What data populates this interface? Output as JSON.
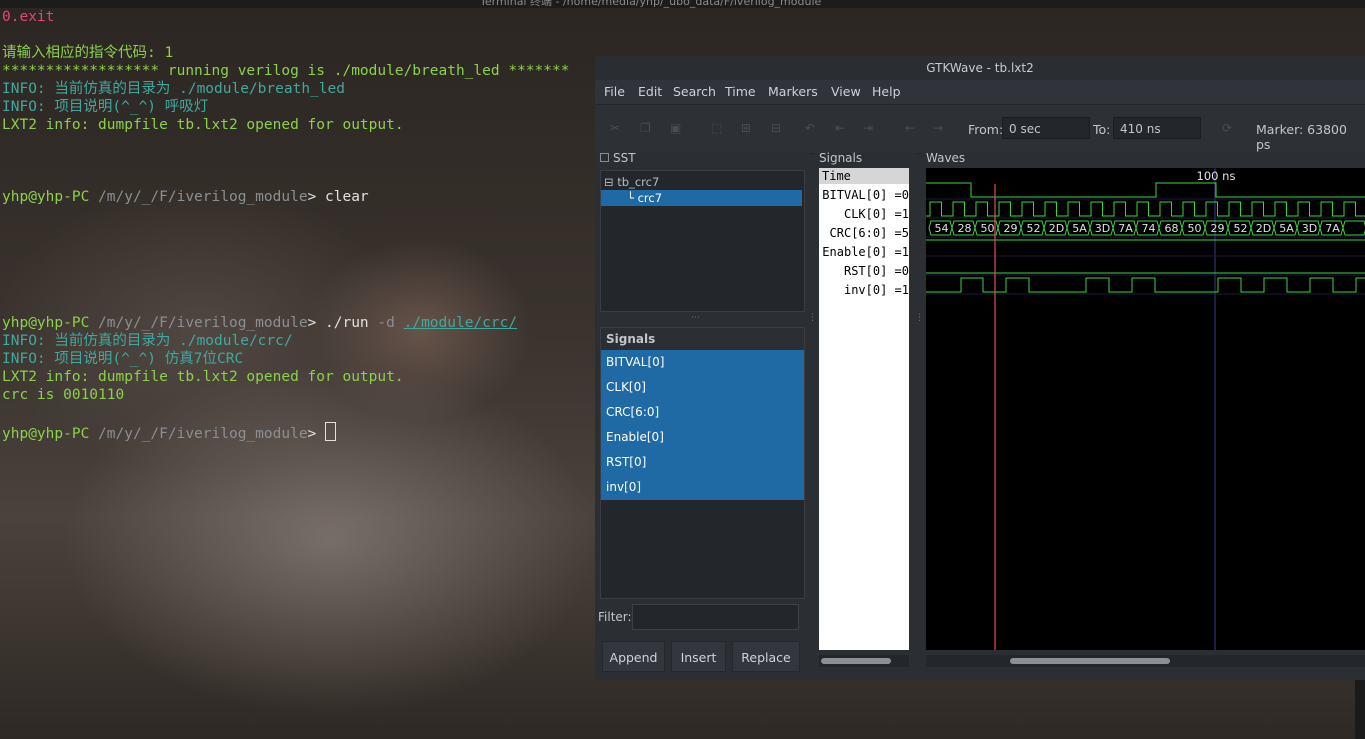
{
  "terminal": {
    "title": "Terminal 终端 - /home/media/yhp/_ubo_data/F/iverilog_module",
    "lines": [
      {
        "segs": [
          {
            "t": "0.exit",
            "c": "p"
          }
        ]
      },
      {
        "segs": []
      },
      {
        "segs": [
          {
            "t": "请输入相应的指令代码: 1",
            "c": "g"
          }
        ]
      },
      {
        "segs": [
          {
            "t": "****************** running verilog is ./module/breath_led *******",
            "c": "g"
          }
        ]
      },
      {
        "segs": [
          {
            "t": "INFO: 当前仿真的目录为 ./module/breath_led",
            "c": "c"
          }
        ]
      },
      {
        "segs": [
          {
            "t": "INFO: 项目说明(^_^) 呼吸灯",
            "c": "c"
          }
        ]
      },
      {
        "segs": [
          {
            "t": "LXT2 info: dumpfile tb.lxt2 opened for output.",
            "c": "g"
          }
        ]
      },
      {
        "segs": []
      },
      {
        "segs": []
      },
      {
        "segs": []
      },
      {
        "segs": [
          {
            "t": "yhp@yhp-PC ",
            "c": "g"
          },
          {
            "t": "/m/y/_/F/iverilog_module",
            "c": "path"
          },
          {
            "t": "> ",
            "c": "w"
          },
          {
            "t": "clear",
            "c": "w"
          }
        ]
      },
      {
        "segs": []
      },
      {
        "segs": []
      },
      {
        "segs": []
      },
      {
        "segs": []
      },
      {
        "segs": []
      },
      {
        "segs": []
      },
      {
        "segs": [
          {
            "t": "yhp@yhp-PC ",
            "c": "g"
          },
          {
            "t": "/m/y/_/F/iverilog_module",
            "c": "path"
          },
          {
            "t": "> ",
            "c": "w"
          },
          {
            "t": "./run ",
            "c": "w"
          },
          {
            "t": "-d ",
            "c": "path"
          },
          {
            "t": "./module/crc/",
            "c": "ul"
          }
        ]
      },
      {
        "segs": [
          {
            "t": "INFO: 当前仿真的目录为 ./module/crc/",
            "c": "c"
          }
        ]
      },
      {
        "segs": [
          {
            "t": "INFO: 项目说明(^_^) 仿真7位CRC",
            "c": "c"
          }
        ]
      },
      {
        "segs": [
          {
            "t": "LXT2 info: dumpfile tb.lxt2 opened for output.",
            "c": "g"
          }
        ]
      },
      {
        "segs": [
          {
            "t": "crc is 0010110",
            "c": "g"
          }
        ]
      },
      {
        "segs": []
      },
      {
        "segs": [
          {
            "t": "yhp@yhp-PC ",
            "c": "g"
          },
          {
            "t": "/m/y/_/F/iverilog_module",
            "c": "path"
          },
          {
            "t": "> ",
            "c": "w"
          }
        ]
      }
    ]
  },
  "gtkwave": {
    "title": "GTKWave - tb.lxt2",
    "menu": [
      "File",
      "Edit",
      "Search",
      "Time",
      "Markers",
      "View",
      "Help"
    ],
    "toolbar": {
      "from_label": "From:",
      "from_value": "0 sec",
      "to_label": "To:",
      "to_value": "410 ns",
      "marker": "Marker: 63800 ps"
    },
    "sst": {
      "label": "SST",
      "tree": [
        "tb_crc7",
        "crc7"
      ],
      "signals_header": "Signals",
      "signals": [
        "BITVAL[0]",
        "CLK[0]",
        "CRC[6:0]",
        "Enable[0]",
        "RST[0]",
        "inv[0]"
      ],
      "filter_label": "Filter:",
      "buttons": {
        "append": "Append",
        "insert": "Insert",
        "replace": "Replace"
      }
    },
    "signals_pane": {
      "label": "Signals",
      "time_header": "Time",
      "rows": [
        "BITVAL[0] =0",
        "CLK[0] =1",
        "CRC[6:0] =5",
        "Enable[0] =1",
        "RST[0] =0",
        "inv[0] =1"
      ]
    },
    "waves_pane": {
      "label": "Waves",
      "time_marker_label": "100 ns",
      "crc_values": [
        "54",
        "28",
        "50",
        "29",
        "52",
        "2D",
        "5A",
        "3D",
        "7A",
        "74",
        "68",
        "50",
        "29",
        "52",
        "2D",
        "5A",
        "3D",
        "7A"
      ]
    },
    "colors": {
      "wave": "#3bd43b",
      "marker": "#e05050",
      "selection": "#1f6aa5"
    }
  }
}
